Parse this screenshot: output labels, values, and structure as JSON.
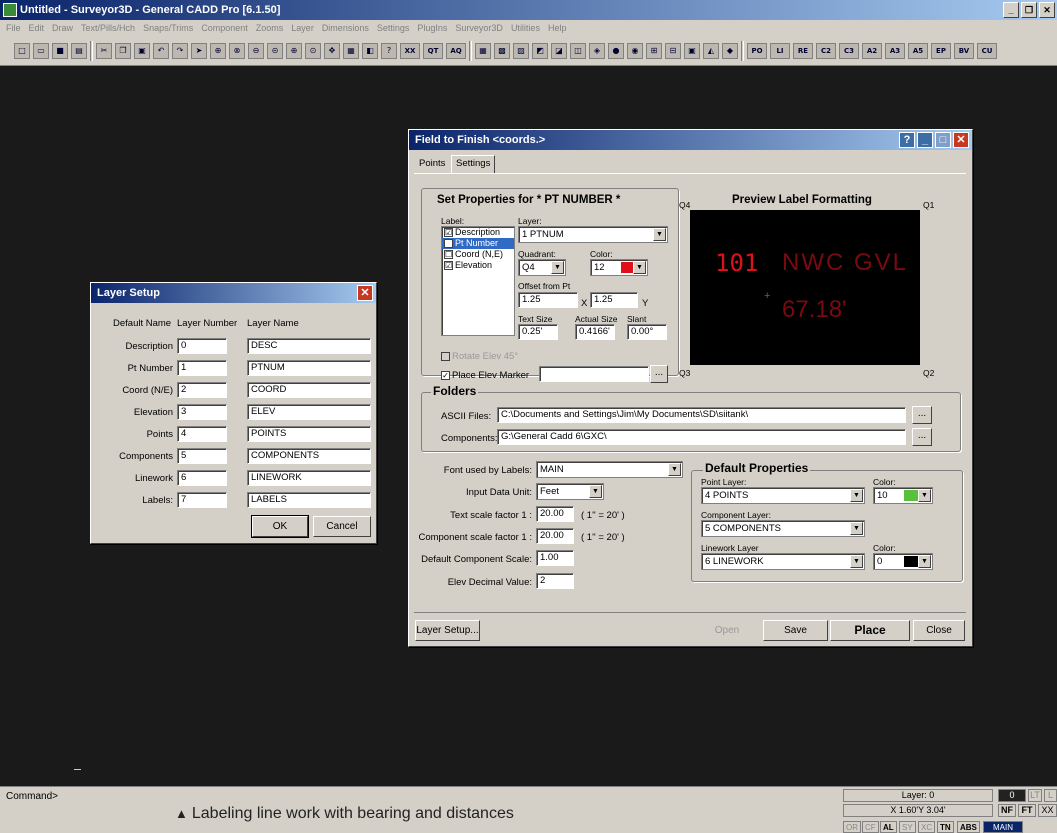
{
  "app": {
    "title": "Untitled - Surveyor3D - General CADD Pro [6.1.50]",
    "min": "_",
    "max": "❐",
    "close": "✕"
  },
  "menu": [
    "File",
    "Edit",
    "Draw",
    "Text/Pills/Hch",
    "Snaps/Trims",
    "Component",
    "Zooms",
    "Layer",
    "Dimensions",
    "Settings",
    "PlugIns",
    "Surveyor3D",
    "Utilities",
    "Help"
  ],
  "toolbar": {
    "text_buttons": [
      "XX",
      "QT",
      "AQ",
      "PO",
      "LI",
      "RE",
      "C2",
      "C3",
      "A2",
      "A3",
      "A5",
      "EP",
      "BV",
      "CU"
    ]
  },
  "status": {
    "command": "Command>",
    "layer": "Layer: 0",
    "coords": "X 1.60'Y 3.04'",
    "toggles": [
      "OR",
      "CF",
      "AL",
      "SY",
      "XC",
      "TN",
      "ABS",
      "MAIN"
    ],
    "right_top": [
      "0",
      "LT",
      "L"
    ],
    "right_mid": [
      "NF",
      "FT",
      "XX"
    ]
  },
  "caption": {
    "marker": "▲",
    "text": "Labeling line work with bearing and distances"
  },
  "layer_setup": {
    "title": "Layer Setup",
    "headers": {
      "default_name": "Default Name",
      "layer_number": "Layer Number",
      "layer_name": "Layer Name"
    },
    "rows": [
      {
        "name": "Description",
        "number": "0",
        "layer": "DESC"
      },
      {
        "name": "Pt Number",
        "number": "1",
        "layer": "PTNUM"
      },
      {
        "name": "Coord (N/E)",
        "number": "2",
        "layer": "COORD"
      },
      {
        "name": "Elevation",
        "number": "3",
        "layer": "ELEV"
      },
      {
        "name": "Points",
        "number": "4",
        "layer": "POINTS"
      },
      {
        "name": "Components",
        "number": "5",
        "layer": "COMPONENTS"
      },
      {
        "name": "Linework",
        "number": "6",
        "layer": "LINEWORK"
      },
      {
        "name": "Labels:",
        "number": "7",
        "layer": "LABELS"
      }
    ],
    "ok": "OK",
    "cancel": "Cancel"
  },
  "ftf": {
    "title": "Field to Finish <coords.>",
    "tabs": [
      "Points",
      "Settings"
    ],
    "set_props": "Set Properties for  * PT NUMBER *",
    "label_caption": "Label:",
    "labels": [
      {
        "text": "Description",
        "checked": "☑"
      },
      {
        "text": "Pt Number",
        "checked": "☑"
      },
      {
        "text": "Coord (N,E)",
        "checked": "☐"
      },
      {
        "text": "Elevation",
        "checked": "☑"
      }
    ],
    "layer_caption": "Layer:",
    "layer_value": "1 PTNUM",
    "quadrant_caption": "Quadrant:",
    "quadrant_value": "Q4",
    "color_caption": "Color:",
    "color_value": "12",
    "color_hex": "#e0101a",
    "offset_caption": "Offset from Pt",
    "offset_x": "1.25",
    "offset_x_lbl": "X",
    "offset_y": "1.25",
    "offset_y_lbl": "Y",
    "text_size_caption": "Text Size",
    "text_size": "0.25'",
    "actual_size_caption": "Actual Size",
    "actual_size": "0.4166'",
    "slant_caption": "Slant",
    "slant": "0.00°",
    "rotate_elev": "Rotate Elev 45°",
    "place_elev": "Place Elev Marker",
    "preview_title": "Preview Label Formatting",
    "q1": "Q1",
    "q2": "Q2",
    "q3": "Q3",
    "q4": "Q4",
    "preview_num": "101",
    "preview_desc": "NWC GVL",
    "preview_elev": "67.18'",
    "folders_title": "Folders",
    "ascii_caption": "ASCII Files:",
    "ascii_path": "C:\\Documents and Settings\\Jim\\My Documents\\SD\\siitank\\",
    "components_caption": "Components:",
    "components_path": "G:\\General Cadd 6\\GXC\\",
    "browse": "...",
    "font_caption": "Font used by Labels:",
    "font_value": "MAIN",
    "input_unit_caption": "Input Data Unit:",
    "input_unit": "Feet",
    "text_scale_caption": "Text scale factor  1 :",
    "text_scale": "20.00",
    "text_scale_note": "( 1'' = 20' )",
    "comp_scale_caption": "Component scale factor  1 :",
    "comp_scale": "20.00",
    "comp_scale_note": "( 1'' = 20' )",
    "default_comp_caption": "Default Component Scale:",
    "default_comp": "1.00",
    "elev_dec_caption": "Elev Decimal Value:",
    "elev_dec": "2",
    "default_props_title": "Default Properties",
    "point_layer_caption": "Point Layer:",
    "point_layer": "4 POINTS",
    "point_color_caption": "Color:",
    "point_color": "10",
    "point_color_hex": "#58c03a",
    "comp_layer_caption": "Component Layer:",
    "comp_layer": "5 COMPONENTS",
    "line_layer_caption": "Linework Layer",
    "line_layer": "6 LINEWORK",
    "line_color_caption": "Color:",
    "line_color": "0",
    "line_color_hex": "#000000",
    "buttons": {
      "layer_setup": "Layer Setup...",
      "open": "Open",
      "save": "Save",
      "place": "Place",
      "close": "Close"
    }
  }
}
